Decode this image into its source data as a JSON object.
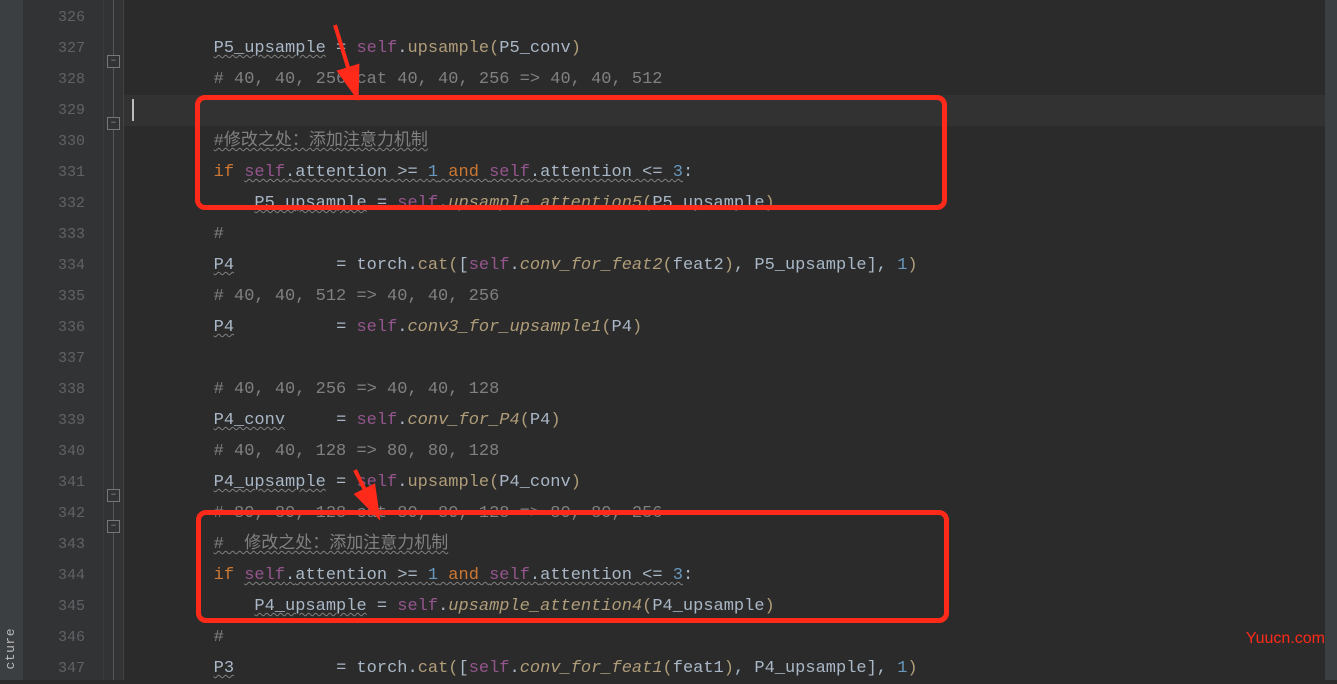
{
  "side_tab": {
    "label": "cture"
  },
  "line_numbers": [
    "326",
    "327",
    "328",
    "329",
    "330",
    "331",
    "332",
    "333",
    "334",
    "335",
    "336",
    "337",
    "338",
    "339",
    "340",
    "341",
    "342",
    "343",
    "344",
    "345",
    "346",
    "347"
  ],
  "code": {
    "l327": {
      "var": "P5_upsample",
      "eq": " = ",
      "self": "self",
      "dot": ".",
      "fn": "upsample",
      "open": "(",
      "arg": "P5_conv",
      "close": ")"
    },
    "l328": {
      "c": "# 40, 40, 256 cat 40, 40, 256 => 40, 40, 512"
    },
    "l330": {
      "c": "#修改之处：添加注意力机制"
    },
    "l331": {
      "kw_if": "if ",
      "self1": "self",
      "d1": ".",
      "attr1": "attention",
      "op1": " >= ",
      "n1": "1",
      "kw_and": " and ",
      "self2": "self",
      "d2": ".",
      "attr2": "attention",
      "op2": " <= ",
      "n2": "3",
      "colon": ":"
    },
    "l332": {
      "var": "P5_upsample",
      "eq": " = ",
      "self": "self",
      "dot": ".",
      "fn": "upsample_attention5",
      "open": "(",
      "arg": "P5_upsample",
      "close": ")"
    },
    "l333": {
      "c": "#"
    },
    "l334": {
      "var": "P4",
      "pad": "          ",
      "eq": "= ",
      "mod": "torch",
      "dot": ".",
      "fn": "cat",
      "open": "(",
      "open2": "[",
      "self": "self",
      "d2": ".",
      "fn2": "conv_for_feat2",
      "open3": "(",
      "arg": "feat2",
      "close3": ")",
      "comma": ", ",
      "arg2": "P5_upsample",
      "close2": "]",
      "comma2": ", ",
      "n": "1",
      "close": ")"
    },
    "l335": {
      "c": "# 40, 40, 512 => 40, 40, 256"
    },
    "l336": {
      "var": "P4",
      "pad": "          ",
      "eq": "= ",
      "self": "self",
      "dot": ".",
      "fn": "conv3_for_upsample1",
      "open": "(",
      "arg": "P4",
      "close": ")"
    },
    "l338": {
      "c": "# 40, 40, 256 => 40, 40, 128"
    },
    "l339": {
      "var": "P4_conv",
      "pad": "     ",
      "eq": "= ",
      "self": "self",
      "dot": ".",
      "fn": "conv_for_P4",
      "open": "(",
      "arg": "P4",
      "close": ")"
    },
    "l340": {
      "c": "# 40, 40, 128 => 80, 80, 128"
    },
    "l341": {
      "var": "P4_upsample",
      "eq": " = ",
      "self": "self",
      "dot": ".",
      "fn": "upsample",
      "open": "(",
      "arg": "P4_conv",
      "close": ")"
    },
    "l342": {
      "c": "# 80, 80, 128 cat 80, 80, 128 => 80, 80, 256"
    },
    "l343": {
      "c": "#  修改之处：添加注意力机制"
    },
    "l344": {
      "kw_if": "if ",
      "self1": "self",
      "d1": ".",
      "attr1": "attention",
      "op1": " >= ",
      "n1": "1",
      "kw_and": " and ",
      "self2": "self",
      "d2": ".",
      "attr2": "attention",
      "op2": " <= ",
      "n2": "3",
      "colon": ":"
    },
    "l345": {
      "var": "P4_upsample",
      "eq": " = ",
      "self": "self",
      "dot": ".",
      "fn": "upsample_attention4",
      "open": "(",
      "arg": "P4_upsample",
      "close": ")"
    },
    "l346": {
      "c": "#"
    },
    "l347": {
      "var": "P3",
      "pad": "          ",
      "eq": "= ",
      "mod": "torch",
      "dot": ".",
      "fn": "cat",
      "open": "(",
      "open2": "[",
      "self": "self",
      "d2": ".",
      "fn2": "conv_for_feat1",
      "open3": "(",
      "arg": "feat1",
      "close3": ")",
      "comma": ", ",
      "arg2": "P4_upsample",
      "close2": "]",
      "comma2": ", ",
      "n": "1",
      "close": ")"
    }
  },
  "watermark": "Yuucn.com"
}
